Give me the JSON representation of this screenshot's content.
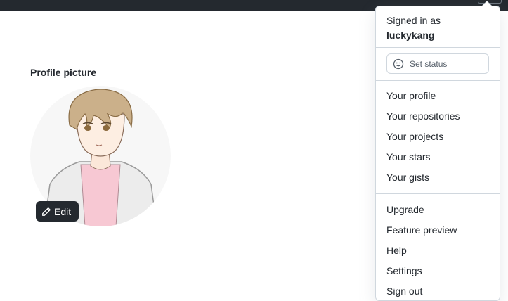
{
  "profile": {
    "picture_label": "Profile picture",
    "edit_label": "Edit"
  },
  "menu": {
    "signed_in_as": "Signed in as",
    "username": "luckykang",
    "set_status": "Set status",
    "group1": [
      "Your profile",
      "Your repositories",
      "Your projects",
      "Your stars",
      "Your gists"
    ],
    "group2": [
      "Upgrade",
      "Feature preview",
      "Help",
      "Settings",
      "Sign out"
    ]
  }
}
